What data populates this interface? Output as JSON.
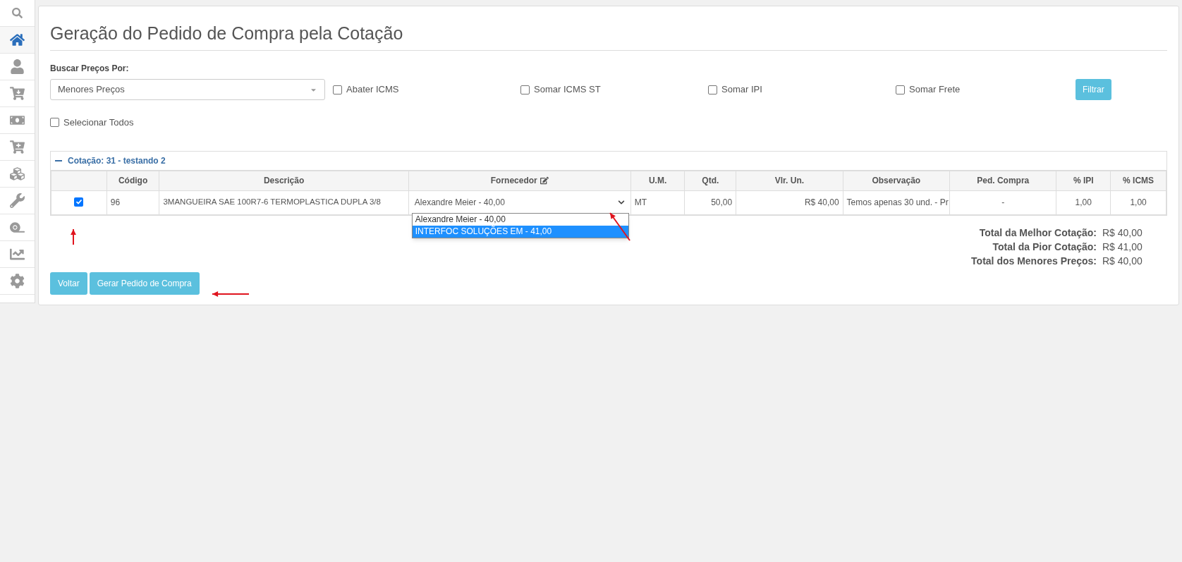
{
  "sidebar": {
    "items": [
      {
        "selected": false
      },
      {
        "selected": true
      },
      {
        "selected": false
      },
      {
        "selected": false
      },
      {
        "selected": false
      },
      {
        "selected": false
      },
      {
        "selected": false
      },
      {
        "selected": false
      },
      {
        "selected": false
      },
      {
        "selected": false
      },
      {
        "selected": false
      }
    ]
  },
  "title": "Geração do Pedido de Compra pela Cotação",
  "filter": {
    "label": "Buscar Preços Por:",
    "select_value": "Menores Preços",
    "options": [
      {
        "label": "Abater ICMS",
        "checked": false
      },
      {
        "label": "Somar ICMS ST",
        "checked": false
      },
      {
        "label": "Somar IPI",
        "checked": false
      },
      {
        "label": "Somar Frete",
        "checked": false
      }
    ],
    "button": "Filtrar",
    "select_all": {
      "label": "Selecionar Todos",
      "checked": false
    }
  },
  "panel": {
    "title": "Cotação: 31 - testando 2",
    "expanded": true,
    "columns": [
      "",
      "Código",
      "Descrição",
      "Fornecedor",
      "U.M.",
      "Qtd.",
      "Vlr. Un.",
      "Observação",
      "Ped. Compra",
      "% IPI",
      "% ICMS"
    ],
    "rows": [
      {
        "checked": true,
        "code": "96",
        "description": "3MANGUEIRA SAE 100R7-6 TERMOPLASTICA DUPLA 3/8",
        "supplier": "Alexandre Meier - 40,00",
        "supplier_open": true,
        "supplier_options": [
          {
            "label": "Alexandre Meier - 40,00",
            "selected": false
          },
          {
            "label": "INTERFOC SOLUÇÕES EM - 41,00",
            "selected": true
          }
        ],
        "um": "MT",
        "qty": "50,00",
        "unit_price": "R$ 40,00",
        "note": "Temos apenas 30 und. - Pr",
        "order": "-",
        "ipi": "1,00",
        "icms": "1,00"
      }
    ]
  },
  "totals": [
    {
      "label": "Total da Melhor Cotação:",
      "value": "R$ 40,00"
    },
    {
      "label": "Total da Pior Cotação:",
      "value": "R$ 41,00"
    },
    {
      "label": "Total dos Menores Preços:",
      "value": "R$ 40,00"
    }
  ],
  "buttons": [
    "Voltar",
    "Gerar Pedido de Compra"
  ]
}
